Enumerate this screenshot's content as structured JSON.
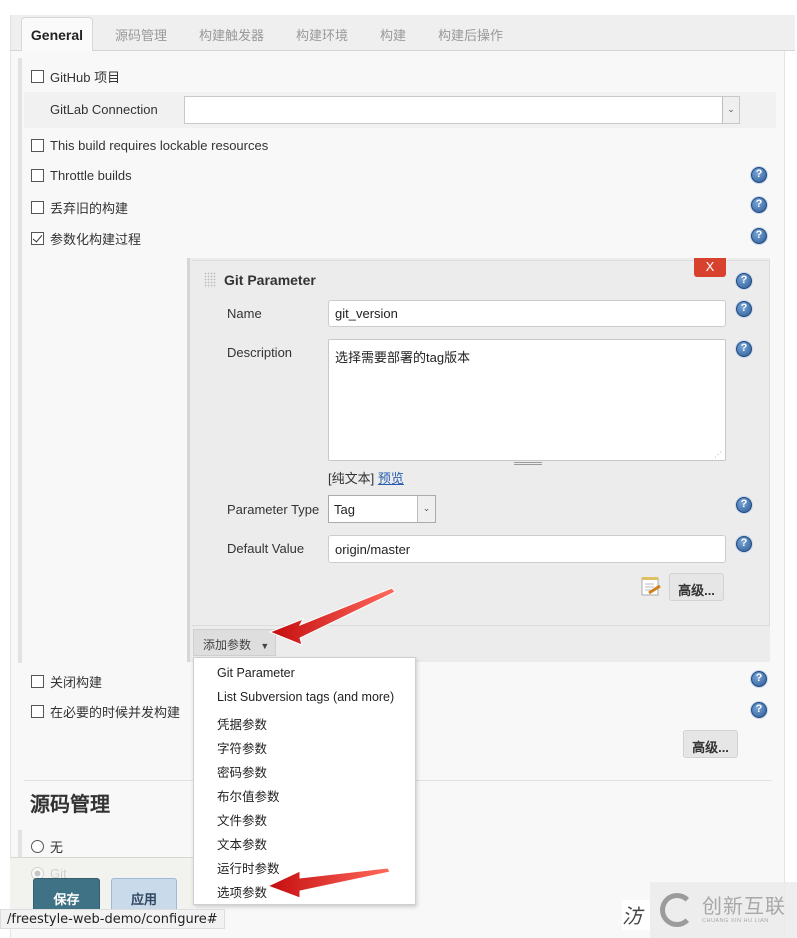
{
  "tabs": [
    {
      "label": "General",
      "active": true
    },
    {
      "label": "源码管理",
      "active": false
    },
    {
      "label": "构建触发器",
      "active": false
    },
    {
      "label": "构建环境",
      "active": false
    },
    {
      "label": "构建",
      "active": false
    },
    {
      "label": "构建后操作",
      "active": false
    }
  ],
  "general": {
    "github_project": {
      "label": "GitHub 项目",
      "checked": false
    },
    "gitlab_connection": {
      "label": "GitLab Connection",
      "value": ""
    },
    "lockable_resources": {
      "label": "This build requires lockable resources",
      "checked": false
    },
    "throttle_builds": {
      "label": "Throttle builds",
      "checked": false
    },
    "discard_old_builds": {
      "label": "丢弃旧的构建",
      "checked": false
    },
    "parameterized": {
      "label": "参数化构建过程",
      "checked": true
    },
    "disable_build": {
      "label": "关闭构建",
      "checked": false
    },
    "concurrent_build": {
      "label": "在必要的时候并发构建",
      "checked": false
    },
    "advanced_label": "高级..."
  },
  "git_parameter": {
    "title": "Git Parameter",
    "delete_label": "X",
    "name_label": "Name",
    "name_value": "git_version",
    "description_label": "Description",
    "description_value": "选择需要部署的tag版本",
    "plain_text_label": "[纯文本]",
    "preview_label": "预览",
    "parameter_type_label": "Parameter Type",
    "parameter_type_value": "Tag",
    "default_value_label": "Default Value",
    "default_value": "origin/master",
    "advanced_label": "高级..."
  },
  "add_parameter": {
    "label": "添加参数",
    "menu_items": [
      "Git Parameter",
      "List Subversion tags (and more)",
      "凭据参数",
      "字符参数",
      "密码参数",
      "布尔值参数",
      "文件参数",
      "文本参数",
      "运行时参数",
      "选项参数"
    ]
  },
  "scm": {
    "title": "源码管理",
    "options": [
      {
        "label": "无",
        "selected": false
      },
      {
        "label": "Git",
        "selected": true
      }
    ]
  },
  "footer": {
    "save_label": "保存",
    "apply_label": "应用"
  },
  "status_url": "/freestyle-web-demo/configure#",
  "watermark": {
    "cn": "创新互联",
    "en": "CHUANG XIN HU LIAN"
  },
  "colors": {
    "delete_button": "#d9412f",
    "save_button": "#3f7285",
    "apply_button": "#c9daea",
    "link": "#2a5db0",
    "annotation_arrow": "#e0191b"
  }
}
